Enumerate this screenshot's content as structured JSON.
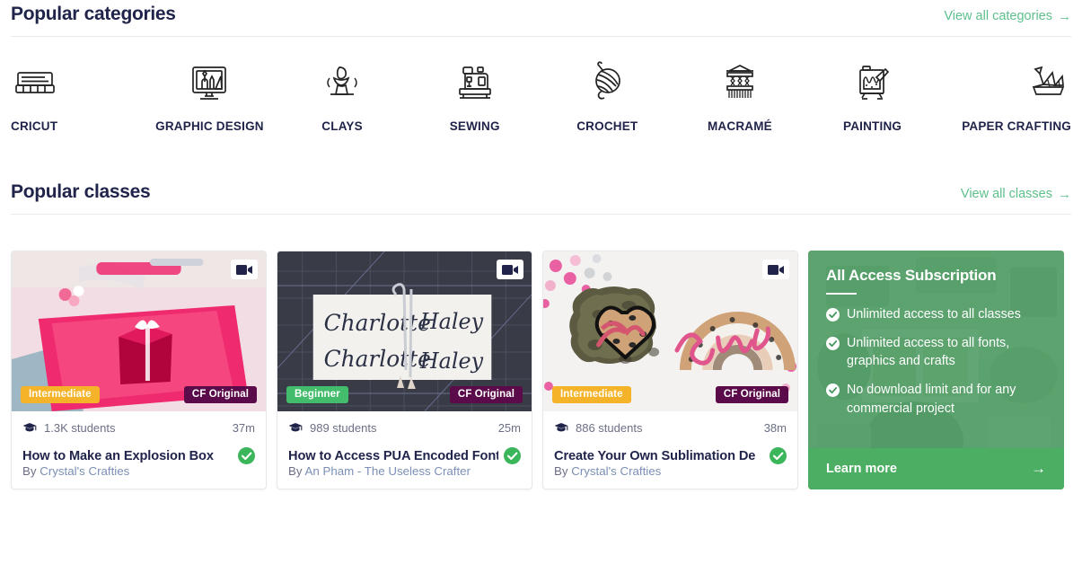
{
  "sections": {
    "categories": {
      "title": "Popular categories",
      "view_all_label": "View all categories",
      "arrow": "→"
    },
    "classes": {
      "title": "Popular classes",
      "view_all_label": "View all classes",
      "arrow": "→"
    }
  },
  "colors": {
    "accent_green": "#5dc08c",
    "heading_navy": "#20244a",
    "badge_intermediate": "#f5b32a",
    "badge_beginner": "#43bd6b",
    "badge_cf_original": "#5b0b49",
    "promo_green": "#4a9c62",
    "promo_cta_green": "#4cae63",
    "verified_green": "#3cb65a",
    "author_blue": "#7b8fb5"
  },
  "categories": [
    {
      "label": "CRICUT",
      "icon": "cricut-machine-icon"
    },
    {
      "label": "GRAPHIC DESIGN",
      "icon": "monitor-design-icon"
    },
    {
      "label": "CLAYS",
      "icon": "pottery-wheel-icon"
    },
    {
      "label": "SEWING",
      "icon": "sewing-machine-icon"
    },
    {
      "label": "CROCHET",
      "icon": "yarn-ball-icon"
    },
    {
      "label": "MACRAMÉ",
      "icon": "macrame-wall-hanging-icon"
    },
    {
      "label": "PAINTING",
      "icon": "paint-easel-icon"
    },
    {
      "label": "PAPER CRAFTING",
      "icon": "origami-swan-icon"
    }
  ],
  "classes": [
    {
      "level": "Intermediate",
      "level_color": "#f5b32a",
      "original_badge": "CF Original",
      "video_icon": "video-camera-icon",
      "video_badge_white": true,
      "students": "1.3K students",
      "duration": "37m",
      "title": "How to Make an Explosion Box",
      "verified_icon": "verified-check-icon",
      "by_label": "By",
      "author": "Crystal's Crafties",
      "thumb": "gift-box-pink-paper"
    },
    {
      "level": "Beginner",
      "level_color": "#43bd6b",
      "original_badge": "CF Original",
      "video_icon": "video-camera-icon",
      "video_badge_white": true,
      "students": "989 students",
      "duration": "25m",
      "title": "How to Access PUA Encoded Font",
      "verified_icon": "verified-check-icon",
      "by_label": "By",
      "author": "An Pham - The Useless Crafter",
      "thumb": "cutting-mat-calligraphy-names"
    },
    {
      "level": "Intermediate",
      "level_color": "#f5b32a",
      "original_badge": "CF Original",
      "video_icon": "video-camera-icon",
      "video_badge_white": true,
      "students": "886 students",
      "duration": "38m",
      "title": "Create Your Own Sublimation De",
      "verified_icon": "verified-check-icon",
      "by_label": "By",
      "author": "Crystal's Crafties",
      "thumb": "sublimation-leopard-heart-rainbow"
    }
  ],
  "promo": {
    "title": "All Access Subscription",
    "features": [
      "Unlimited access to all classes",
      "Unlimited access to all fonts, graphics and crafts",
      "No download limit and for any commercial project"
    ],
    "check_icon": "check-circle-icon",
    "cta_label": "Learn more",
    "cta_arrow": "→"
  }
}
